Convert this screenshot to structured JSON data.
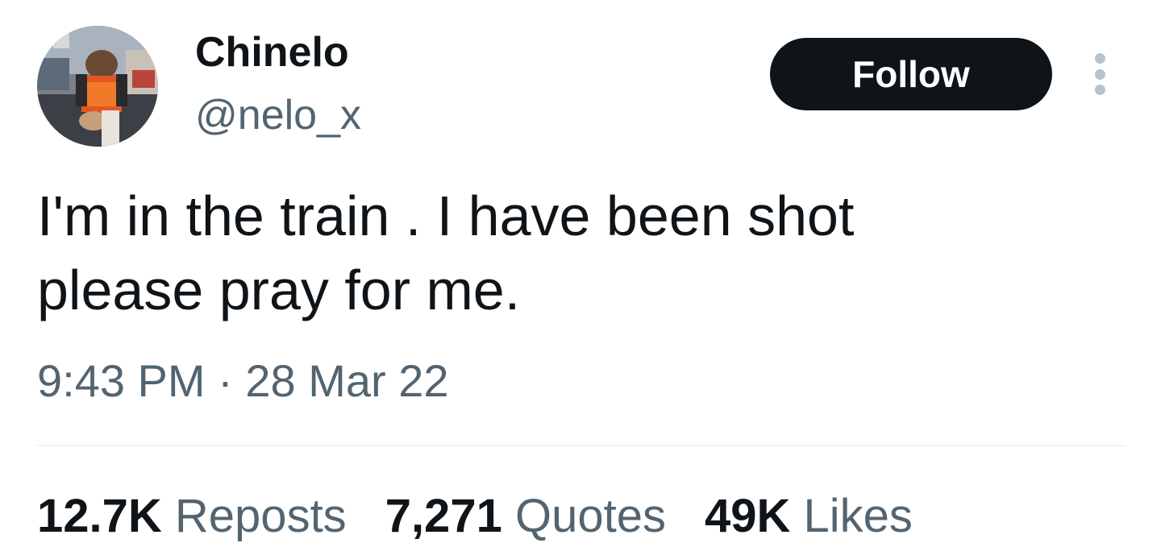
{
  "author": {
    "display_name": "Chinelo",
    "handle": "@nelo_x"
  },
  "actions": {
    "follow_label": "Follow",
    "more_icon": "more-vertical-icon"
  },
  "tweet": {
    "line1": "I'm in the train .  I have been shot",
    "line2": "please pray for me.",
    "time": "9:43 PM",
    "separator": "·",
    "date": "28 Mar 22"
  },
  "stats": [
    {
      "value": "12.7K",
      "label": "Reposts"
    },
    {
      "value": "7,271",
      "label": "Quotes"
    },
    {
      "value": "49K",
      "label": "Likes"
    }
  ],
  "colors": {
    "text": "#0f1419",
    "secondary_text": "#536471",
    "follow_bg": "#0f1419",
    "divider": "#eff3f4"
  }
}
